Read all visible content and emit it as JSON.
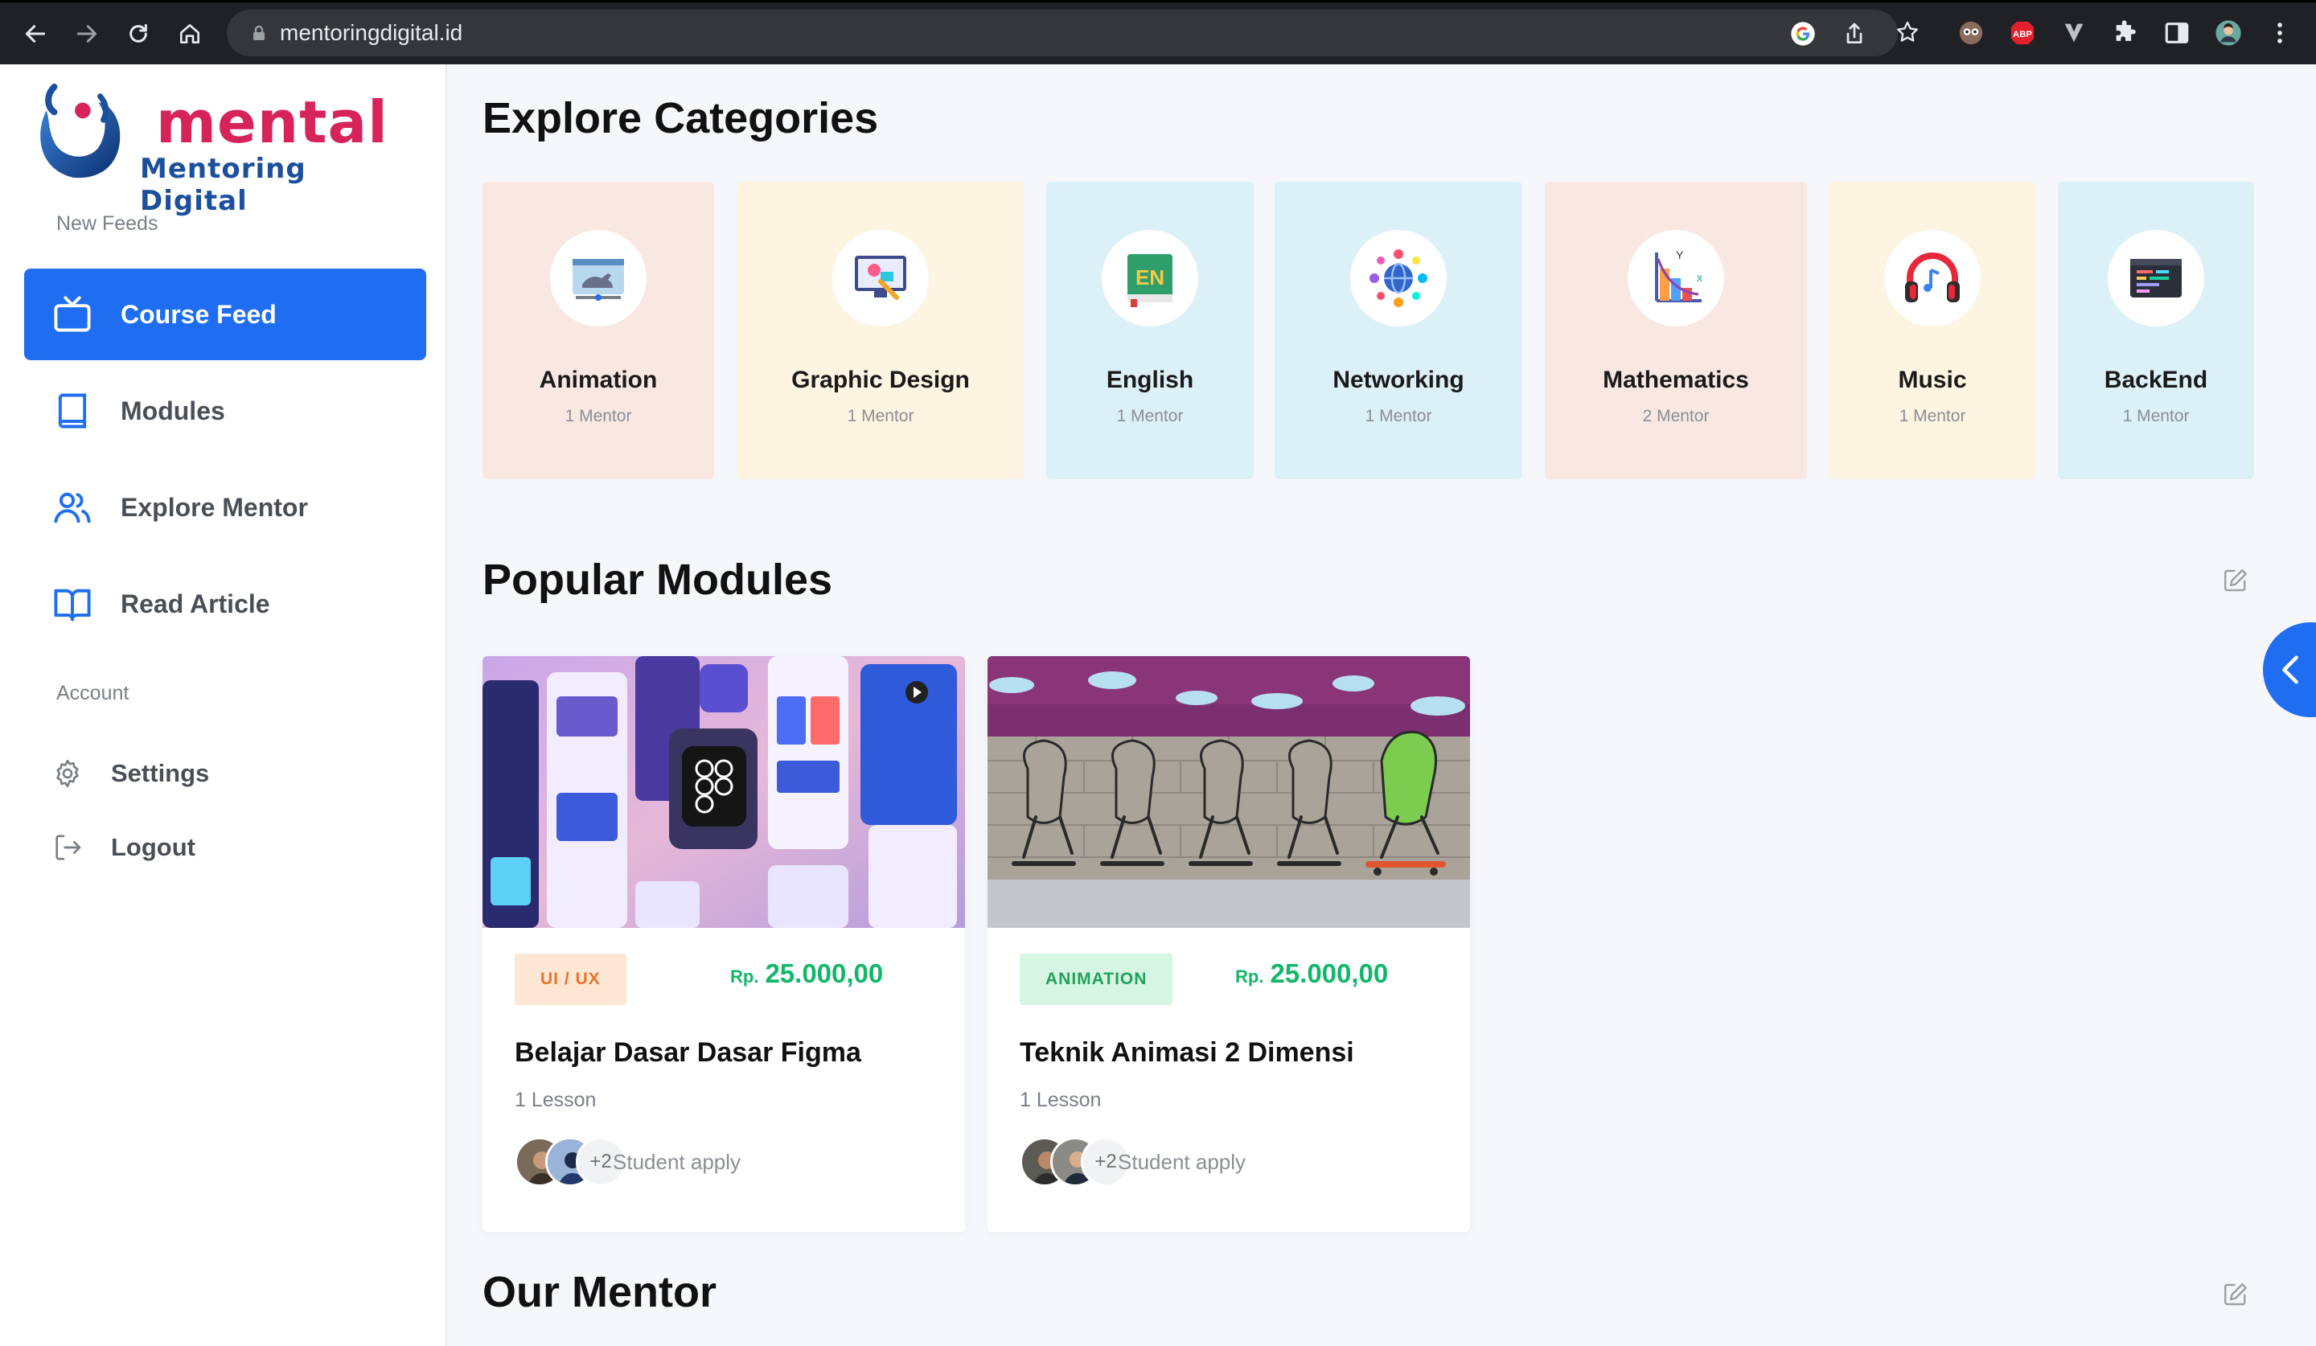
{
  "browser": {
    "url": "mentoringdigital.id"
  },
  "sidebar": {
    "brand_name": "mental",
    "brand_sub": "Mentoring Digital",
    "section_feeds": "New Feeds",
    "items": [
      {
        "label": "Course Feed",
        "icon": "tv-icon",
        "active": true
      },
      {
        "label": "Modules",
        "icon": "book-icon",
        "active": false
      },
      {
        "label": "Explore Mentor",
        "icon": "users-icon",
        "active": false
      },
      {
        "label": "Read Article",
        "icon": "open-book-icon",
        "active": false
      }
    ],
    "section_account": "Account",
    "account_items": [
      {
        "label": "Settings",
        "icon": "gear-icon"
      },
      {
        "label": "Logout",
        "icon": "logout-icon"
      }
    ]
  },
  "categories": {
    "heading_light": "Explore",
    "heading_bold": "Categories",
    "items": [
      {
        "name": "Animation",
        "count": "1 Mentor",
        "bg": "#f9e8e2",
        "icon": "animation-icon"
      },
      {
        "name": "Graphic Design",
        "count": "1 Mentor",
        "bg": "#fdf4e2",
        "icon": "graphic-design-icon"
      },
      {
        "name": "English",
        "count": "1 Mentor",
        "bg": "#dcf0f7",
        "icon": "english-book-icon"
      },
      {
        "name": "Networking",
        "count": "1 Mentor",
        "bg": "#dcf0f7",
        "icon": "network-globe-icon"
      },
      {
        "name": "Mathematics",
        "count": "2 Mentor",
        "bg": "#f9e8e2",
        "icon": "chart-icon"
      },
      {
        "name": "Music",
        "count": "1 Mentor",
        "bg": "#fdf4e2",
        "icon": "headphones-icon"
      },
      {
        "name": "BackEnd",
        "count": "1 Mentor",
        "bg": "#dcf0f7",
        "icon": "code-window-icon"
      }
    ]
  },
  "modules": {
    "heading_light": "Popular",
    "heading_bold": "Modules",
    "items": [
      {
        "tag": "UI / UX",
        "tag_bg": "#fde6d4",
        "tag_color": "#e8742a",
        "currency": "Rp.",
        "price": "25.000,00",
        "title": "Belajar Dasar Dasar Figma",
        "lessons": "1 Lesson",
        "more": "+2",
        "apply": "Student apply"
      },
      {
        "tag": "ANIMATION",
        "tag_bg": "#d6f5e3",
        "tag_color": "#1ea35a",
        "currency": "Rp.",
        "price": "25.000,00",
        "title": "Teknik Animasi 2 Dimensi",
        "lessons": "1 Lesson",
        "more": "+2",
        "apply": "Student apply"
      }
    ]
  },
  "mentor": {
    "heading_light": "Our",
    "heading_bold": "Mentor"
  },
  "colors": {
    "accent": "#1f6ef1",
    "price": "#12b76a",
    "brand_pink": "#d6245a",
    "brand_blue": "#1c4f9c"
  }
}
